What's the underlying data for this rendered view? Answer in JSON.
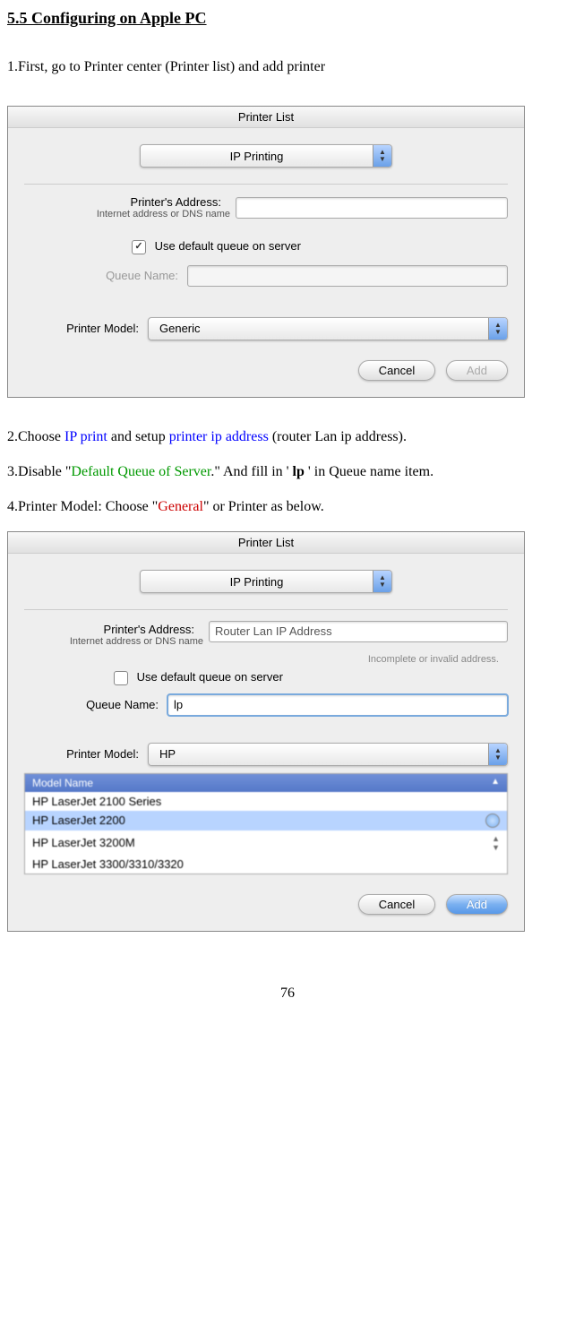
{
  "heading": "5.5 Configuring on Apple PC",
  "step1": "1.First, go to Printer center (Printer list) and add printer",
  "step2": {
    "prefix": "2.Choose ",
    "link1": "IP print",
    "mid": " and setup ",
    "link2": "printer ip address",
    "suffix": " (router Lan ip address)."
  },
  "step3": {
    "prefix": "3.Disable \"",
    "green": "Default Queue of  Server",
    "mid": ".\" And fill in ' ",
    "bold": "lp",
    "suffix": " ' in Queue name item."
  },
  "step4": {
    "prefix": "4.Printer Model: Choose \"",
    "red": "General",
    "suffix": "\" or Printer as below."
  },
  "dialog1": {
    "title": "Printer List",
    "connection_type": "IP Printing",
    "addr_label": "Printer's Address:",
    "addr_sub": "Internet address or DNS name",
    "use_default_label": "Use default queue on server",
    "queue_label": "Queue Name:",
    "model_label": "Printer Model:",
    "model_value": "Generic",
    "cancel": "Cancel",
    "add": "Add"
  },
  "dialog2": {
    "title": "Printer List",
    "connection_type": "IP Printing",
    "addr_label": "Printer's Address:",
    "addr_value": "Router Lan IP Address",
    "addr_sub": "Internet address or DNS name",
    "invalid_msg": "Incomplete or invalid address.",
    "use_default_label": "Use default queue on server",
    "queue_label": "Queue Name:",
    "queue_value": "lp",
    "model_label": "Printer Model:",
    "model_value": "HP",
    "list_header": "Model Name",
    "models": [
      "HP LaserJet 2100 Series",
      "HP LaserJet 2200",
      "HP LaserJet 3200M",
      "HP LaserJet 3300/3310/3320"
    ],
    "cancel": "Cancel",
    "add": "Add"
  },
  "page_number": "76"
}
